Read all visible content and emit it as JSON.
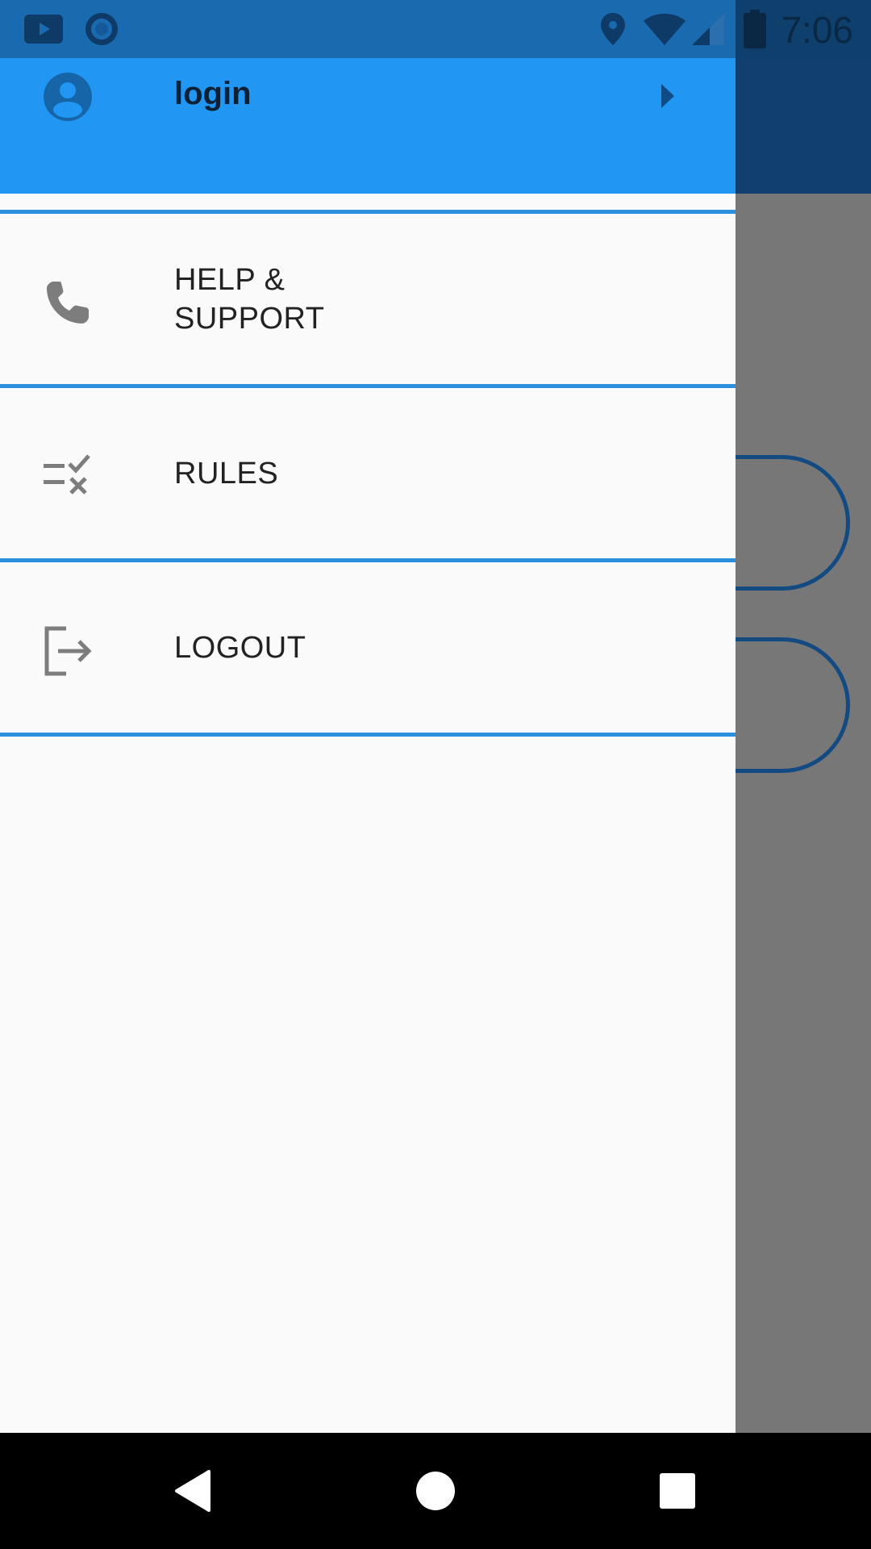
{
  "status_bar": {
    "time": "7:06",
    "icons": [
      "youtube-icon",
      "circle-app-icon",
      "location-icon",
      "wifi-icon",
      "cellular-signal-icon",
      "battery-icon"
    ]
  },
  "drawer": {
    "header": {
      "label": "login",
      "accent_color": "#2196f3"
    },
    "items": [
      {
        "label": "HELP &\n SUPPORT",
        "icon": "phone-icon"
      },
      {
        "label": "RULES",
        "icon": "rules-checklist-icon"
      },
      {
        "label": "LOGOUT",
        "icon": "logout-icon"
      }
    ],
    "divider_color": "#2a90de"
  },
  "nav_bar": {
    "buttons": [
      "back-icon",
      "home-icon",
      "recents-icon"
    ]
  }
}
